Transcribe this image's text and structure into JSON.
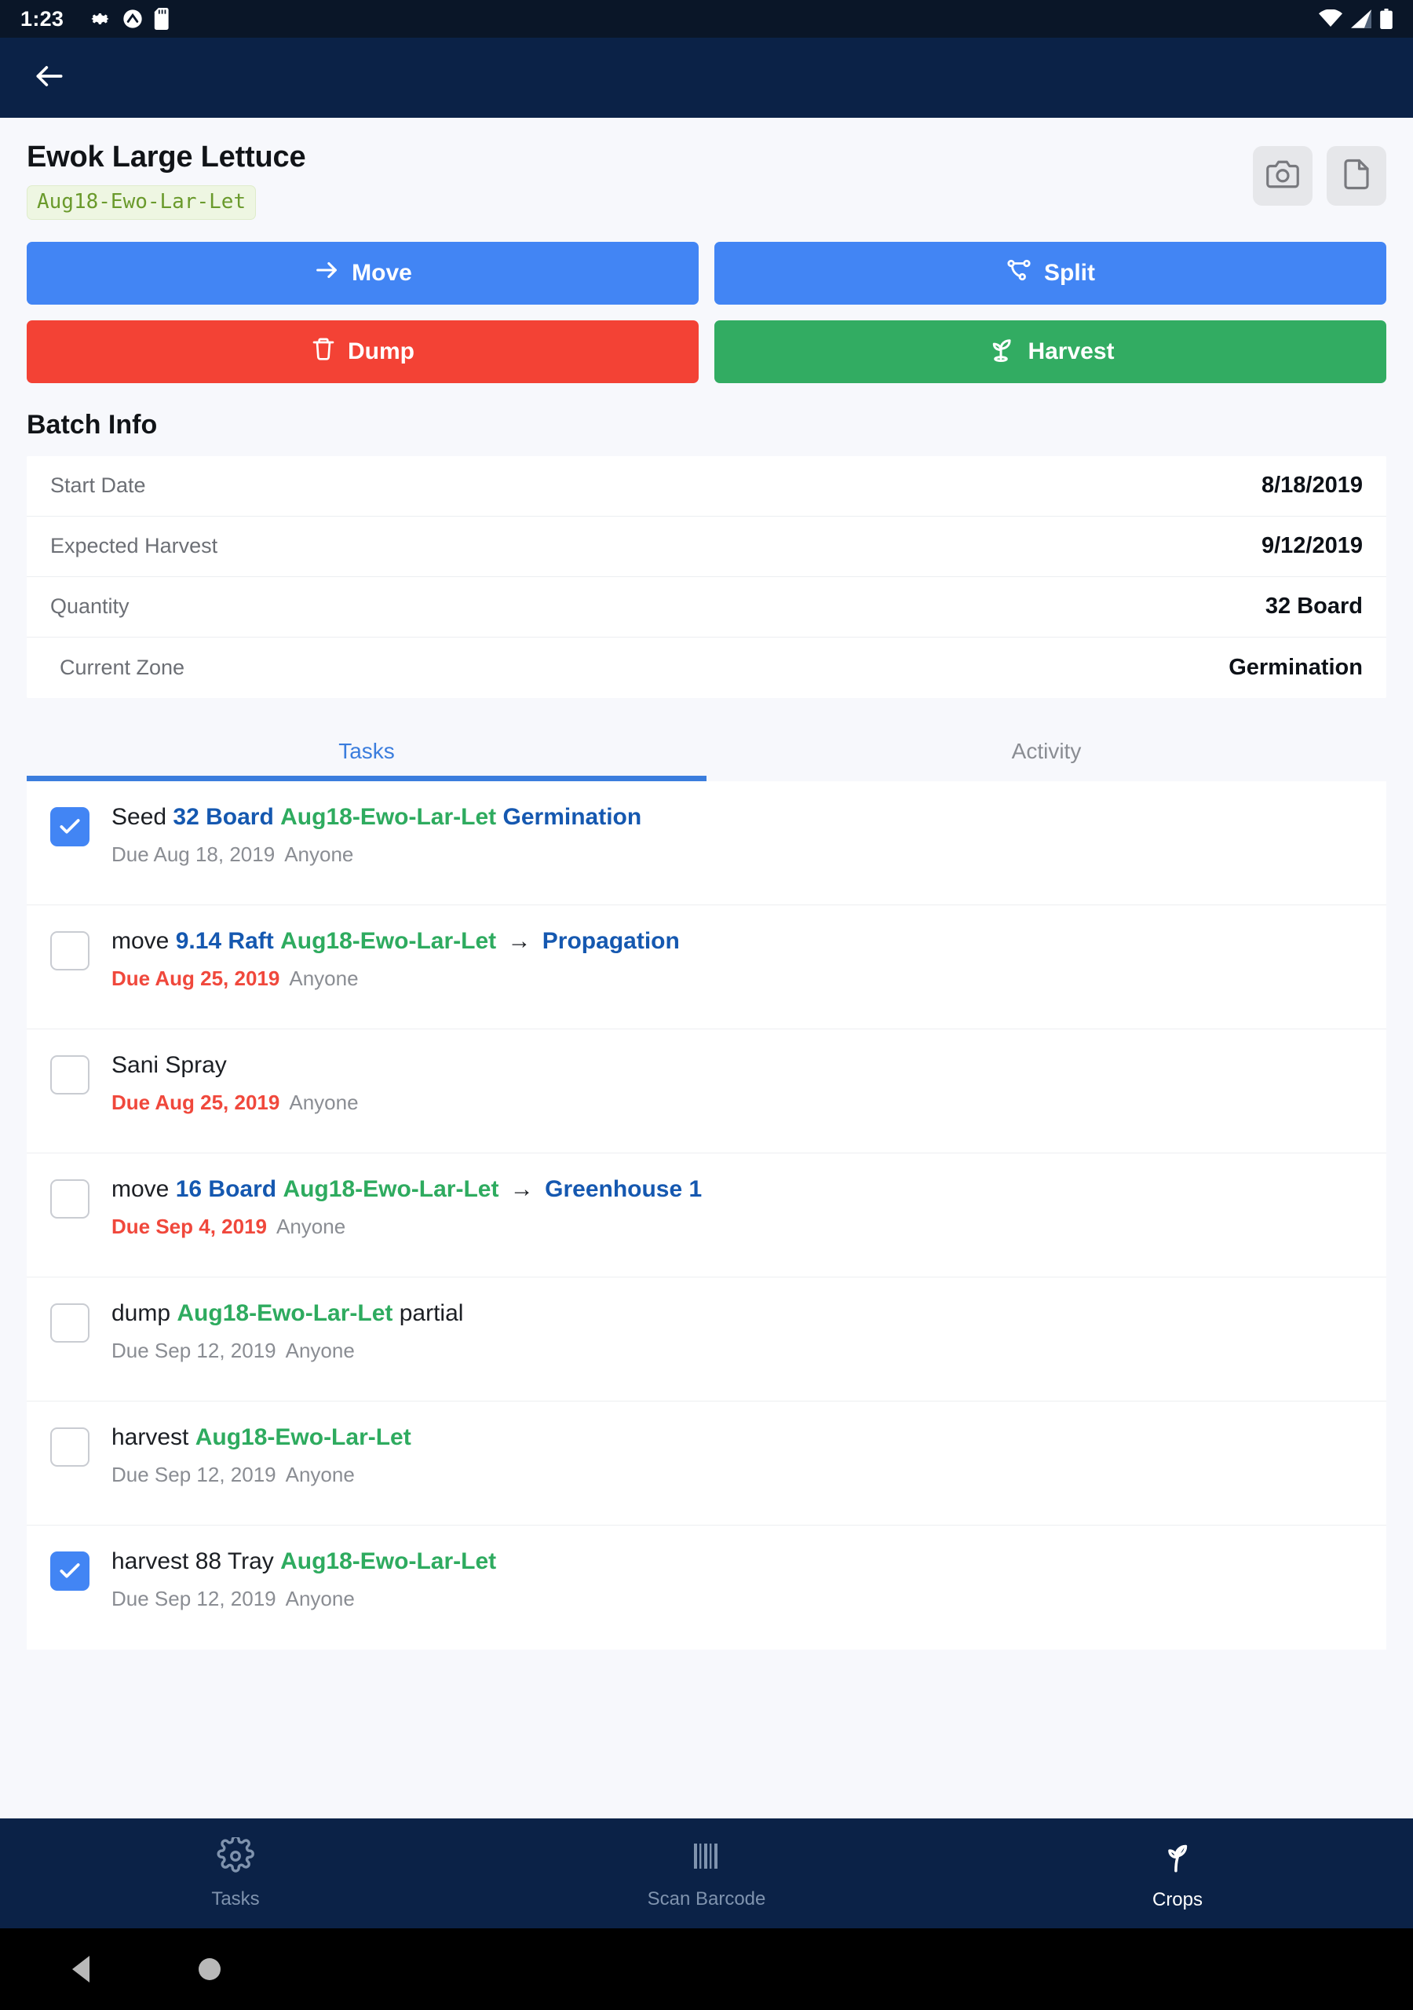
{
  "status_bar": {
    "time": "1:23",
    "left_icons": [
      "gear-icon",
      "app-circle-icon",
      "sd-card-icon"
    ],
    "right_icons": [
      "wifi-icon",
      "cell-signal-icon",
      "battery-icon"
    ]
  },
  "app_bar": {
    "back_icon": "arrow-left-icon",
    "bg_color": "#0b2247"
  },
  "header": {
    "title": "Ewok Large Lettuce",
    "code": "Aug18-Ewo-Lar-Let",
    "camera_icon": "camera-icon",
    "document_icon": "document-icon"
  },
  "actions": [
    {
      "label": "Move",
      "icon": "arrow-right-icon",
      "color": "#4285f4"
    },
    {
      "label": "Split",
      "icon": "split-branch-icon",
      "color": "#4285f4"
    },
    {
      "label": "Dump",
      "icon": "trash-icon",
      "color": "#f34235"
    },
    {
      "label": "Harvest",
      "icon": "seedling-icon",
      "color": "#32ac62"
    }
  ],
  "batch_info": {
    "section_title": "Batch Info",
    "rows": [
      {
        "label": "Start Date",
        "value": "8/18/2019"
      },
      {
        "label": "Expected Harvest",
        "value": "9/12/2019"
      },
      {
        "label": "Quantity",
        "value": "32 Board"
      },
      {
        "label": "Current Zone",
        "value": "Germination"
      }
    ]
  },
  "tabs": [
    {
      "label": "Tasks",
      "active": true
    },
    {
      "label": "Activity",
      "active": false
    }
  ],
  "tasks": [
    {
      "checked": true,
      "parts": [
        {
          "text": "Seed ",
          "style": "plain"
        },
        {
          "text": "32 Board",
          "style": "blue"
        },
        {
          "text": " ",
          "style": "plain"
        },
        {
          "text": "Aug18-Ewo-Lar-Let",
          "style": "green"
        },
        {
          "text": " ",
          "style": "plain"
        },
        {
          "text": "Germination",
          "style": "blue"
        }
      ],
      "due": "Due Aug 18, 2019",
      "overdue": false,
      "assignee": "Anyone"
    },
    {
      "checked": false,
      "parts": [
        {
          "text": "move ",
          "style": "plain"
        },
        {
          "text": "9.14 Raft",
          "style": "blue"
        },
        {
          "text": " ",
          "style": "plain"
        },
        {
          "text": "Aug18-Ewo-Lar-Let",
          "style": "green"
        },
        {
          "text": " → ",
          "style": "arrow"
        },
        {
          "text": "Propagation",
          "style": "blue"
        }
      ],
      "due": "Due Aug 25, 2019",
      "overdue": true,
      "assignee": "Anyone"
    },
    {
      "checked": false,
      "parts": [
        {
          "text": "Sani Spray",
          "style": "plain"
        }
      ],
      "due": "Due Aug 25, 2019",
      "overdue": true,
      "assignee": "Anyone"
    },
    {
      "checked": false,
      "parts": [
        {
          "text": "move ",
          "style": "plain"
        },
        {
          "text": "16 Board",
          "style": "blue"
        },
        {
          "text": " ",
          "style": "plain"
        },
        {
          "text": "Aug18-Ewo-Lar-Let",
          "style": "green"
        },
        {
          "text": " → ",
          "style": "arrow"
        },
        {
          "text": "Greenhouse 1",
          "style": "blue"
        }
      ],
      "due": "Due Sep 4, 2019",
      "overdue": true,
      "assignee": "Anyone"
    },
    {
      "checked": false,
      "parts": [
        {
          "text": "dump ",
          "style": "plain"
        },
        {
          "text": "Aug18-Ewo-Lar-Let",
          "style": "green"
        },
        {
          "text": " partial",
          "style": "plain"
        }
      ],
      "due": "Due Sep 12, 2019",
      "overdue": false,
      "assignee": "Anyone"
    },
    {
      "checked": false,
      "parts": [
        {
          "text": "harvest  ",
          "style": "plain"
        },
        {
          "text": "Aug18-Ewo-Lar-Let",
          "style": "green"
        }
      ],
      "due": "Due Sep 12, 2019",
      "overdue": false,
      "assignee": "Anyone"
    },
    {
      "checked": true,
      "parts": [
        {
          "text": "harvest 88 Tray ",
          "style": "plain"
        },
        {
          "text": "Aug18-Ewo-Lar-Let",
          "style": "green"
        }
      ],
      "due": "Due Sep 12, 2019",
      "overdue": false,
      "assignee": "Anyone"
    }
  ],
  "bottom_nav": [
    {
      "label": "Tasks",
      "icon": "gear-icon",
      "active": false
    },
    {
      "label": "Scan Barcode",
      "icon": "barcode-icon",
      "active": false
    },
    {
      "label": "Crops",
      "icon": "sprout-icon",
      "active": true
    }
  ],
  "colors": {
    "accent_blue": "#4285f4",
    "danger_red": "#f34235",
    "success_green": "#32ac62",
    "navy": "#0b2247",
    "code_green": "#6a9a2c",
    "link_blue": "#1558b0",
    "tag_green": "#2eab5f",
    "overdue_red": "#f0483c"
  }
}
